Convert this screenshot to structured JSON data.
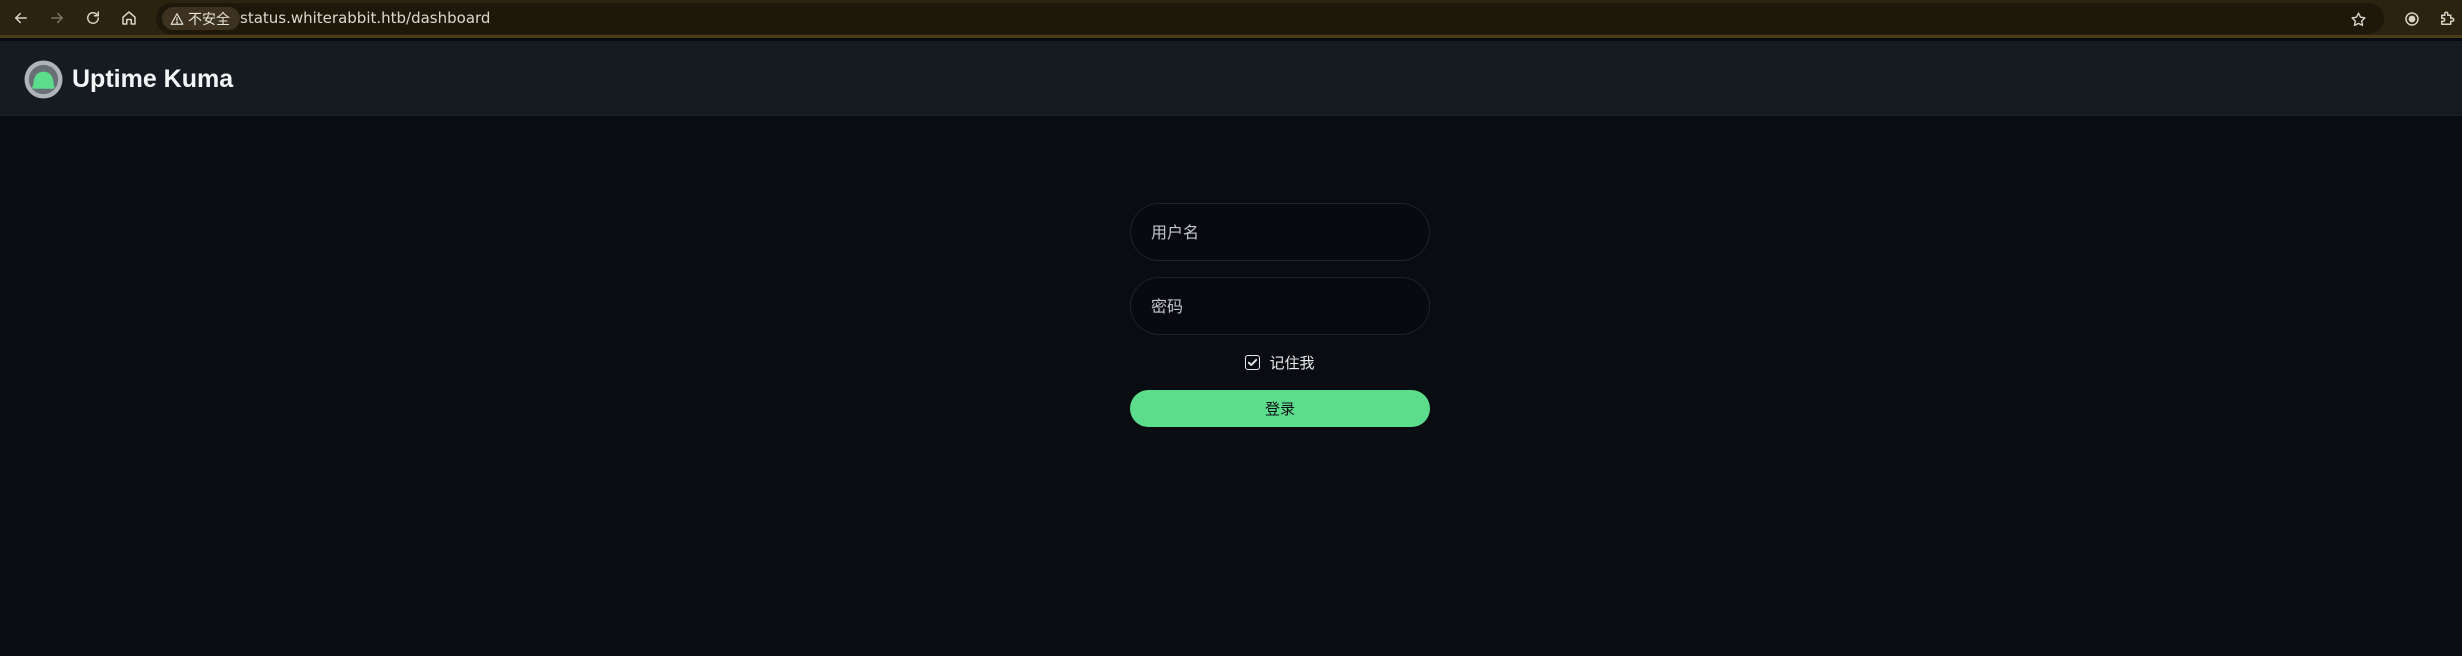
{
  "browser": {
    "security_label": "不安全",
    "url": "status.whiterabbit.htb/dashboard"
  },
  "header": {
    "brand_name": "Uptime Kuma"
  },
  "login": {
    "username_placeholder": "用户名",
    "password_placeholder": "密码",
    "remember_label": "记住我",
    "remember_checked": true,
    "submit_label": "登录"
  },
  "colors": {
    "page_background": "#090c10",
    "header_background": "#161b22",
    "browser_bar": "#2b2210",
    "accent_green": "#5cdd8b"
  },
  "icons": [
    "back-arrow-icon",
    "forward-arrow-icon",
    "reload-icon",
    "home-icon",
    "warning-icon",
    "star-icon",
    "extension-icon",
    "puzzle-icon",
    "uptime-kuma-logo",
    "checkmark-icon"
  ]
}
